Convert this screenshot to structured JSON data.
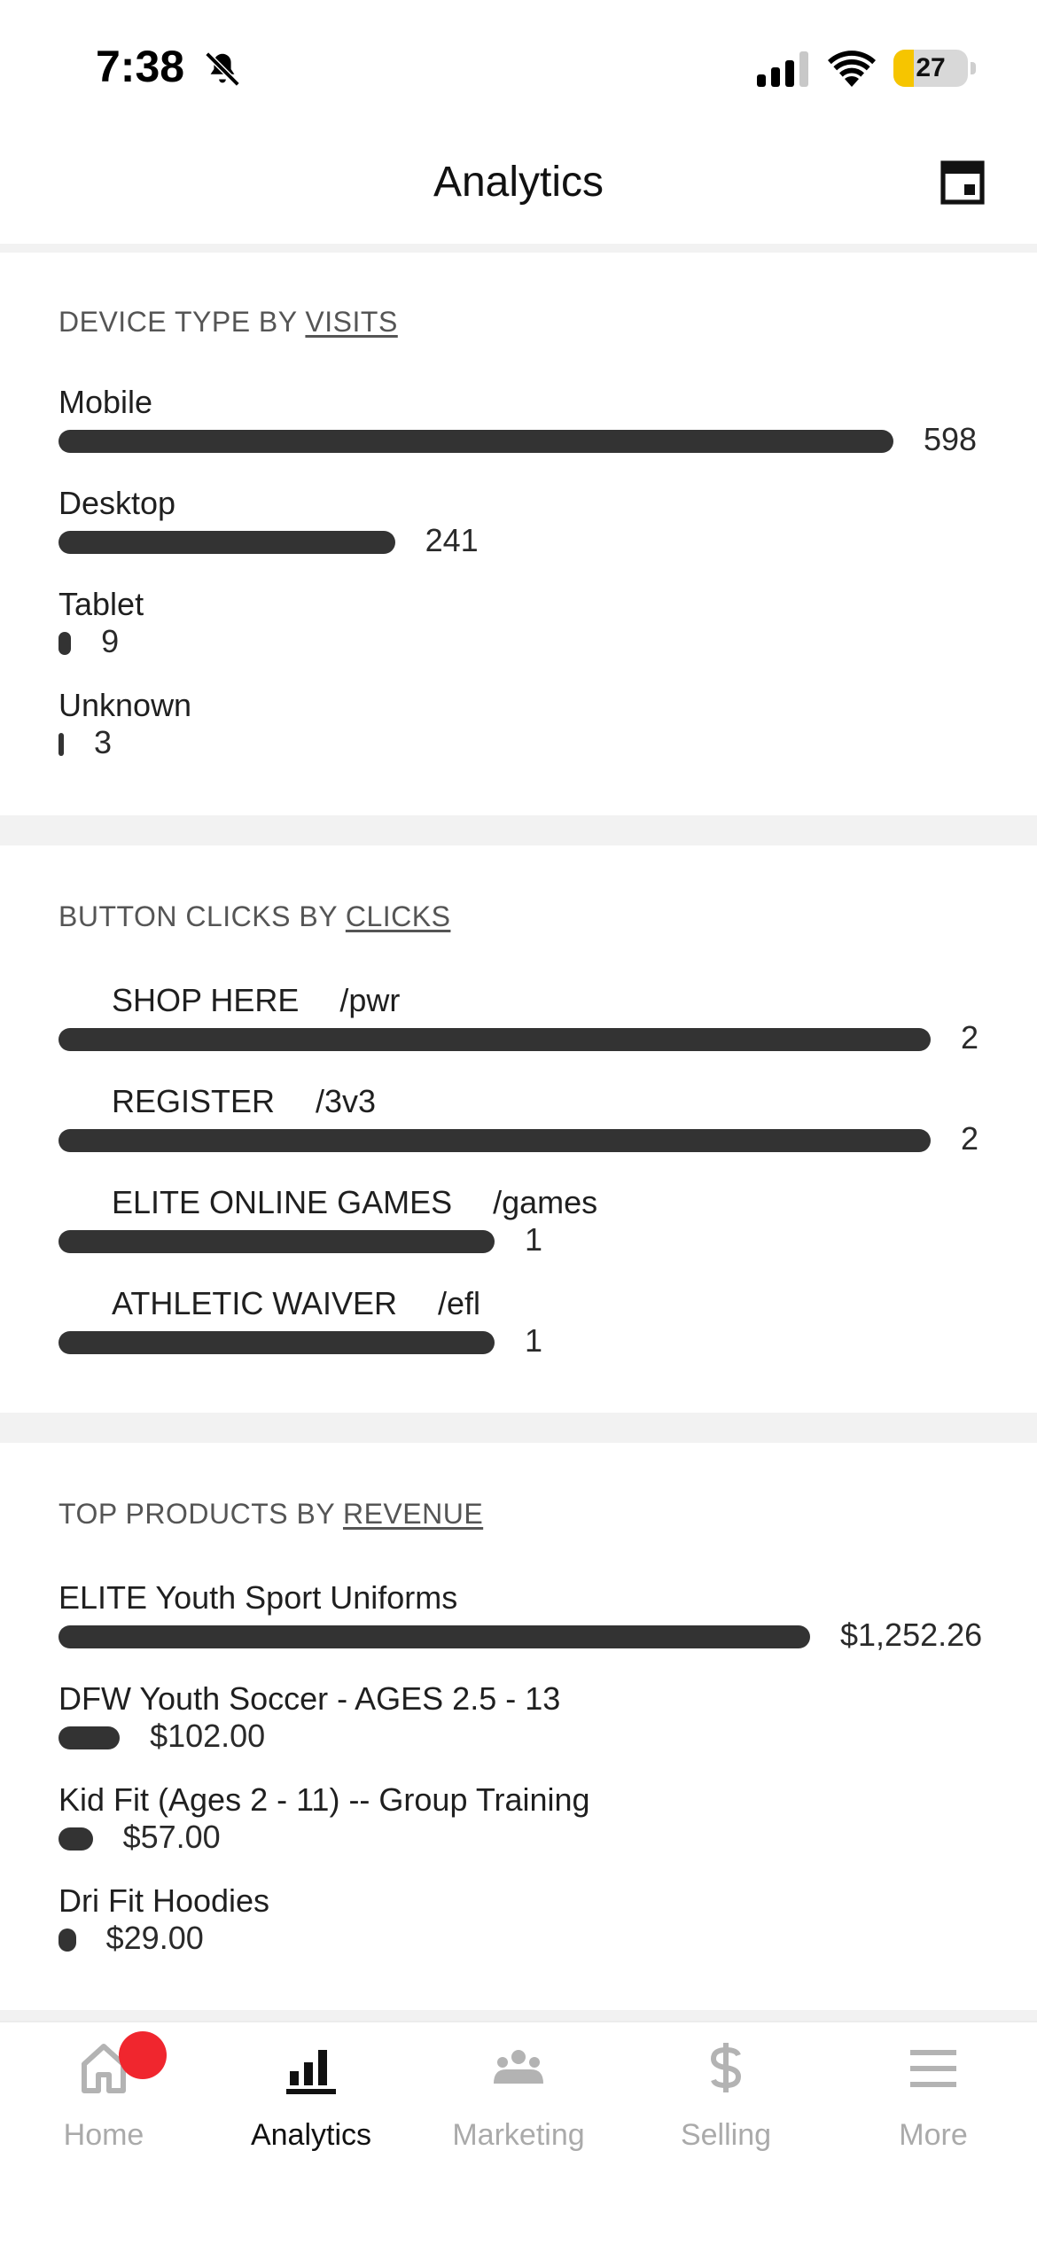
{
  "status_bar": {
    "time": "7:38",
    "battery": "27",
    "battery_level": 0.27
  },
  "header": {
    "title": "Analytics"
  },
  "device_type": {
    "title_prefix": "DEVICE TYPE BY",
    "title_metric": "VISITS",
    "rows": [
      {
        "label": "Mobile",
        "value": "598",
        "amount": 598
      },
      {
        "label": "Desktop",
        "value": "241",
        "amount": 241
      },
      {
        "label": "Tablet",
        "value": "9",
        "amount": 9
      },
      {
        "label": "Unknown",
        "value": "3",
        "amount": 3
      }
    ]
  },
  "button_clicks": {
    "title_prefix": "BUTTON CLICKS BY",
    "title_metric": "CLICKS",
    "rows": [
      {
        "label": "SHOP HERE",
        "path": "/pwr",
        "value": "2",
        "amount": 2
      },
      {
        "label": "REGISTER",
        "path": "/3v3",
        "value": "2",
        "amount": 2
      },
      {
        "label": "ELITE ONLINE GAMES",
        "path": "/games",
        "value": "1",
        "amount": 1
      },
      {
        "label": "ATHLETIC WAIVER",
        "path": "/efl",
        "value": "1",
        "amount": 1
      }
    ]
  },
  "top_products": {
    "title_prefix": "TOP PRODUCTS BY",
    "title_metric": "REVENUE",
    "rows": [
      {
        "label": "ELITE Youth Sport Uniforms",
        "value": "$1,252.26",
        "amount": 1252.26
      },
      {
        "label": "DFW Youth Soccer - AGES 2.5 - 13",
        "value": "$102.00",
        "amount": 102.0
      },
      {
        "label": "Kid Fit (Ages 2 - 11) -- Group Training",
        "value": "$57.00",
        "amount": 57.0
      },
      {
        "label": "Dri Fit Hoodies",
        "value": "$29.00",
        "amount": 29.0
      }
    ]
  },
  "bottom_nav": {
    "items": [
      {
        "label": "Home",
        "icon": "home-icon",
        "active": false,
        "badge": true
      },
      {
        "label": "Analytics",
        "icon": "analytics-icon",
        "active": true,
        "badge": false
      },
      {
        "label": "Marketing",
        "icon": "marketing-icon",
        "active": false,
        "badge": false
      },
      {
        "label": "Selling",
        "icon": "dollar-icon",
        "active": false,
        "badge": false
      },
      {
        "label": "More",
        "icon": "menu-icon",
        "active": false,
        "badge": false
      }
    ]
  },
  "colors": {
    "bar": "#333333",
    "badge": "#f0262e",
    "battery": "#f6c500",
    "inactive": "#aaaaaa"
  }
}
